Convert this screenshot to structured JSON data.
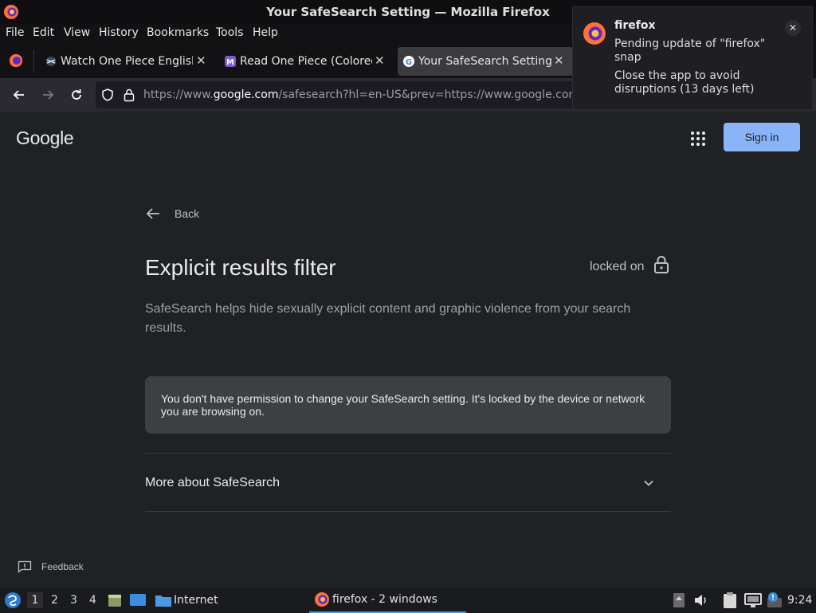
{
  "window": {
    "title": "Your SafeSearch Setting — Mozilla Firefox"
  },
  "menubar": [
    "File",
    "Edit",
    "View",
    "History",
    "Bookmarks",
    "Tools",
    "Help"
  ],
  "tabs": [
    {
      "label": "Watch One Piece English",
      "active": false
    },
    {
      "label": "Read One Piece (Colored",
      "active": false
    },
    {
      "label": "Your SafeSearch Setting",
      "active": true
    }
  ],
  "urlbar": {
    "prefix": "https://www.",
    "domain": "google.com",
    "path": "/safesearch?hl=en-US&prev=https://www.google.com"
  },
  "page": {
    "logo": "Google",
    "sign_in": "Sign in",
    "back": "Back",
    "heading": "Explicit results filter",
    "status": "locked on",
    "description": "SafeSearch helps hide sexually explicit content and graphic violence from your search results.",
    "notice": "You don't have permission to change your SafeSearch setting. It's locked by the device or network you are browsing on.",
    "more": "More about SafeSearch",
    "feedback": "Feedback"
  },
  "notification": {
    "app": "firefox",
    "line1": "Pending update of \"firefox\" snap",
    "line2": "Close the app to avoid disruptions (13 days left)"
  },
  "taskbar": {
    "workspaces": [
      "1",
      "2",
      "3",
      "4"
    ],
    "launcher_label": "Internet",
    "task": "firefox - 2 windows",
    "clock": "9:24"
  },
  "colors": {
    "accent": "#8ab4f8",
    "page_bg": "#202124",
    "notice_bg": "#3c4043"
  }
}
